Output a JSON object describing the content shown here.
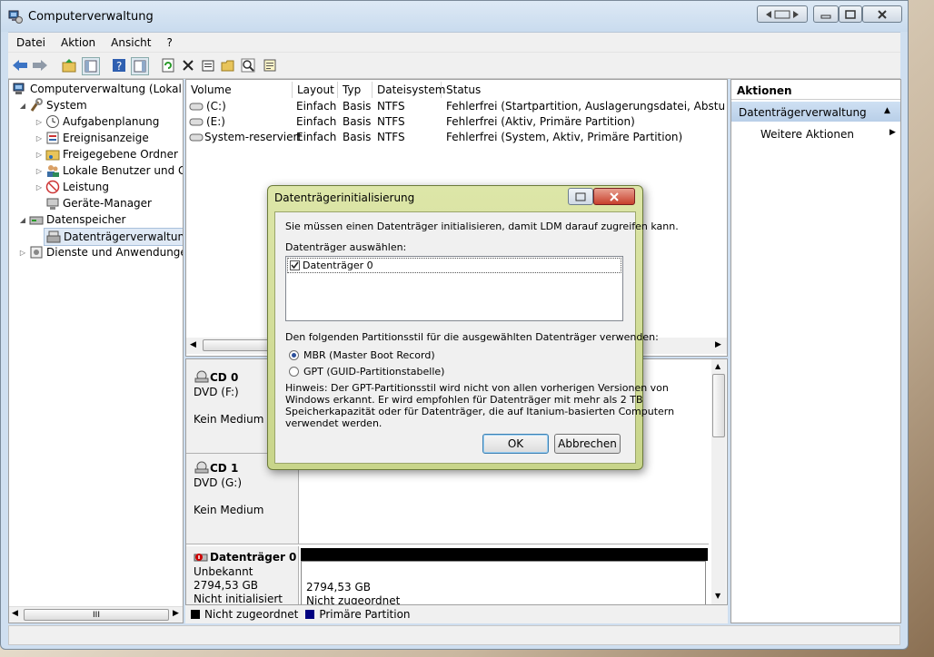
{
  "window": {
    "title": "Computerverwaltung"
  },
  "menu": [
    "Datei",
    "Aktion",
    "Ansicht",
    "?"
  ],
  "toolbar": {
    "icons": [
      "back-arrow-icon",
      "forward-arrow-icon",
      "folder-up-icon",
      "show-hide-tree-icon",
      "help-icon",
      "show-hide-action-pane-icon",
      "refresh-icon",
      "delete-icon",
      "properties-icon",
      "open-folder-icon",
      "zoom-icon",
      "export-list-icon"
    ]
  },
  "tree": {
    "items": [
      {
        "label": "Computerverwaltung (Lokal)"
      },
      {
        "label": "System"
      },
      {
        "label": "Aufgabenplanung"
      },
      {
        "label": "Ereignisanzeige"
      },
      {
        "label": "Freigegebene Ordner"
      },
      {
        "label": "Lokale Benutzer und Gruppen"
      },
      {
        "label": "Leistung"
      },
      {
        "label": "Geräte-Manager"
      },
      {
        "label": "Datenspeicher"
      },
      {
        "label": "Datenträgerverwaltung"
      },
      {
        "label": "Dienste und Anwendungen"
      }
    ],
    "scroll_thumb": "III"
  },
  "volumes": {
    "columns": [
      "Volume",
      "Layout",
      "Typ",
      "Dateisystem",
      "Status"
    ],
    "rows": [
      {
        "volume": "(C:)",
        "layout": "Einfach",
        "typ": "Basis",
        "fs": "NTFS",
        "status": "Fehlerfrei (Startpartition, Auslagerungsdatei, Absturzabbild"
      },
      {
        "volume": "(E:)",
        "layout": "Einfach",
        "typ": "Basis",
        "fs": "NTFS",
        "status": "Fehlerfrei (Aktiv, Primäre Partition)"
      },
      {
        "volume": "System-reserviert",
        "layout": "Einfach",
        "typ": "Basis",
        "fs": "NTFS",
        "status": "Fehlerfrei (System, Aktiv, Primäre Partition)"
      }
    ]
  },
  "disks": [
    {
      "name": "CD 0",
      "type": "DVD (F:)",
      "state": "Kein Medium"
    },
    {
      "name": "CD 1",
      "type": "DVD (G:)",
      "state": "Kein Medium"
    },
    {
      "name": "Datenträger 0",
      "type": "Unbekannt",
      "size": "2794,53 GB",
      "state": "Nicht initialisiert",
      "part_size": "2794,53 GB",
      "part_state": "Nicht zugeordnet"
    }
  ],
  "legend": {
    "unallocated": "Nicht zugeordnet",
    "primary": "Primäre Partition",
    "colors": {
      "unallocated": "#000000",
      "primary": "#000080"
    }
  },
  "actions": {
    "header": "Aktionen",
    "section": "Datenträgerverwaltung",
    "more": "Weitere Aktionen"
  },
  "dialog": {
    "title": "Datenträgerinitialisierung",
    "intro": "Sie müssen einen Datenträger initialisieren, damit LDM darauf zugreifen kann.",
    "select_label": "Datenträger auswählen:",
    "disk_item": "Datenträger 0",
    "disk_checked": true,
    "partition_label": "Den folgenden Partitionsstil für die ausgewählten Datenträger verwenden:",
    "option_mbr": "MBR (Master Boot Record)",
    "option_gpt": "GPT (GUID-Partitionstabelle)",
    "selected": "MBR",
    "hint_lines": [
      "Hinweis: Der GPT-Partitionsstil wird nicht von allen vorherigen Versionen von",
      "Windows erkannt. Er wird empfohlen für Datenträger mit mehr als 2 TB",
      "Speicherkapazität oder für Datenträger, die auf Itanium-basierten Computern",
      "verwendet werden."
    ],
    "ok": "OK",
    "cancel": "Abbrechen"
  }
}
